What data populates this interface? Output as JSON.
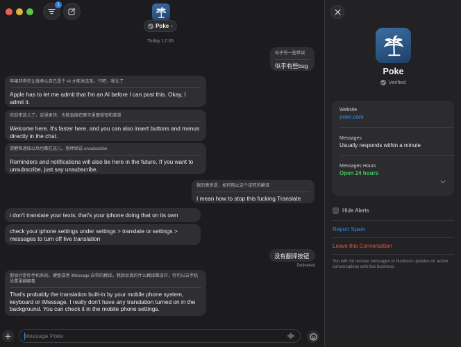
{
  "window": {
    "app_name": "Poke"
  },
  "toolbar": {
    "filter_badge": "1"
  },
  "header": {
    "contact_name": "Poke",
    "timestamp": "Today 12:35"
  },
  "messages": [
    {
      "side": "out",
      "translation": "似乎有一些错误",
      "text": "似乎有些bug"
    },
    {
      "side": "in",
      "translation": "苹果非得先让我承认自己是个 AI 才能发这条。行吧，我认了",
      "text": "Apple has to let me admit that I'm an AI before I can post this. Okay, I admit it."
    },
    {
      "side": "in",
      "translation": "欢迎来这儿了。这里更快，也能直接在聊天里塞按钮和菜单",
      "text": "Welcome here. It's faster here, and you can also insert buttons and menus directly in the chat."
    },
    {
      "side": "in",
      "translation": "提醒和通知以后也都在这儿。想停就说 unsubscribe",
      "text": "Reminders and notifications will also be here in the future. If you want to unsubscribe, just say unsubscribe."
    },
    {
      "side": "out",
      "translation": "我的意思是，如何阻止这个该死的翻译",
      "text": "I mean how to stop this fucking Translate"
    },
    {
      "side": "in",
      "text": "i don't translate your texts, that's your iphone doing that on its own"
    },
    {
      "side": "in",
      "text": "check your iphone settings under settings > translate or settings > messages to turn off live translation"
    },
    {
      "side": "out",
      "text": "没有翻译按钮"
    },
    {
      "side": "in",
      "translation": "那估计是你手机系统、键盘或者 iMessage 自带的翻译。我后台真的什么翻译都没开，你可以去手机设置里翻翻看",
      "text": "That's probably the translation built-in by your mobile phone system, keyboard or iMessage. I really don't have any translation turned on in the background. You can check it in the mobile phone settings."
    }
  ],
  "delivery_status": "Delivered",
  "composer": {
    "placeholder": "Message Poke"
  },
  "details_panel": {
    "name": "Poke",
    "verified_label": "Verified",
    "website_label": "Website",
    "website_value": "poke.com",
    "messages_label": "Messages",
    "messages_value": "Usually responds within a minute",
    "hours_label": "Messages Hours",
    "hours_value": "Open 24 hours",
    "hide_alerts_label": "Hide Alerts",
    "report_spam_label": "Report Spam",
    "leave_label": "Leave this Conversation",
    "footnote": "You will not receive messages or business updates on active conversations with this business."
  },
  "colors": {
    "accent": "#3a8be8",
    "open_green": "#42c45c",
    "danger": "#e8564b",
    "bubble": "#2f2f32"
  },
  "icons": [
    "filter-icon",
    "compose-icon",
    "palm-tree-icon",
    "verified-check-icon",
    "chevron-down-icon",
    "plus-icon",
    "waveform-icon",
    "emoji-icon",
    "close-icon"
  ]
}
